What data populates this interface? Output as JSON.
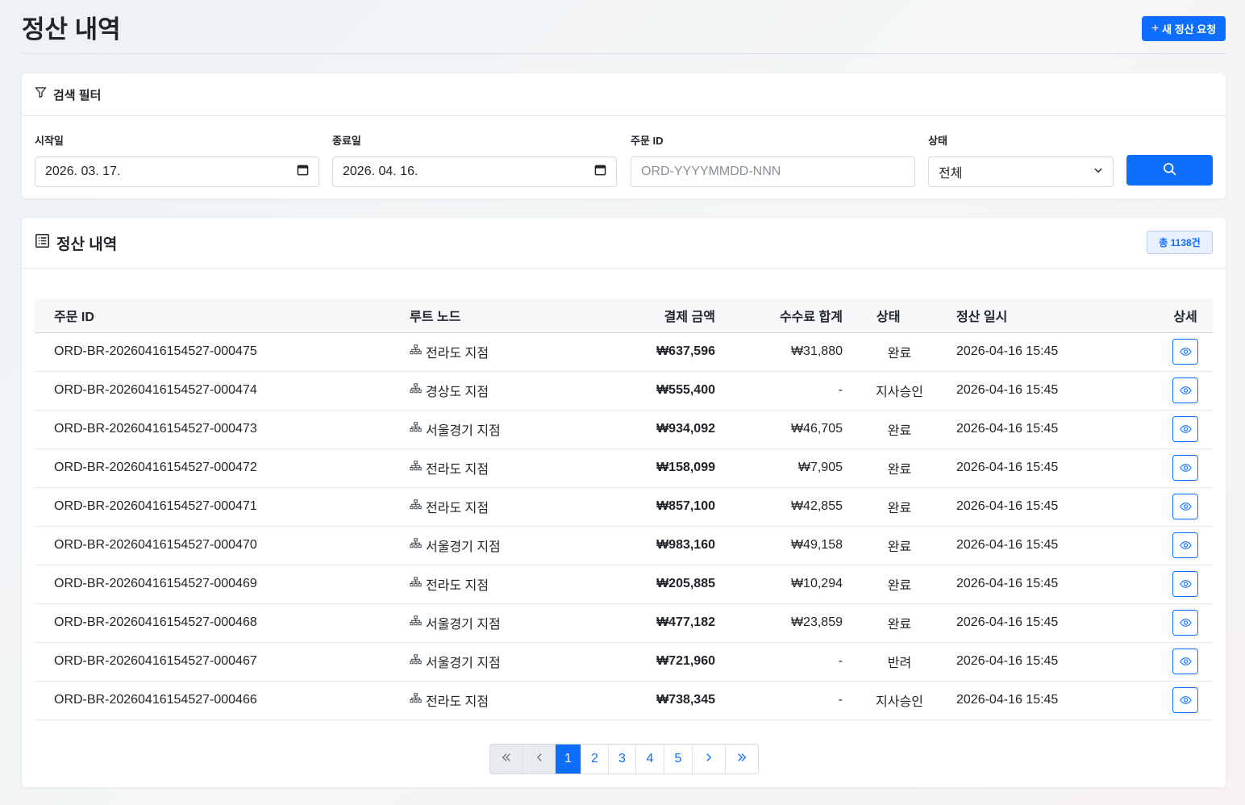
{
  "header": {
    "title": "정산 내역",
    "new_button_label": "새 정산 요청"
  },
  "filter": {
    "title": "검색 필터",
    "start_label": "시작일",
    "start_value": "2026. 03. 17.",
    "end_label": "종료일",
    "end_value": "2026. 04. 16.",
    "order_label": "주문 ID",
    "order_placeholder": "ORD-YYYYMMDD-NNN",
    "status_label": "상태",
    "status_value": "전체"
  },
  "list": {
    "title": "정산 내역",
    "total_badge": "총 1138건",
    "columns": {
      "order_id": "주문 ID",
      "root_node": "루트 노드",
      "amount": "결제 금액",
      "fee": "수수료 합계",
      "status": "상태",
      "settled_at": "정산 일시",
      "detail": "상세"
    },
    "rows": [
      {
        "order_id": "ORD-BR-20260416154527-000475",
        "node": "전라도 지점",
        "amount": "₩637,596",
        "fee": "₩31,880",
        "status": "완료",
        "date": "2026-04-16 15:45"
      },
      {
        "order_id": "ORD-BR-20260416154527-000474",
        "node": "경상도 지점",
        "amount": "₩555,400",
        "fee": "-",
        "status": "지사승인",
        "date": "2026-04-16 15:45"
      },
      {
        "order_id": "ORD-BR-20260416154527-000473",
        "node": "서울경기 지점",
        "amount": "₩934,092",
        "fee": "₩46,705",
        "status": "완료",
        "date": "2026-04-16 15:45"
      },
      {
        "order_id": "ORD-BR-20260416154527-000472",
        "node": "전라도 지점",
        "amount": "₩158,099",
        "fee": "₩7,905",
        "status": "완료",
        "date": "2026-04-16 15:45"
      },
      {
        "order_id": "ORD-BR-20260416154527-000471",
        "node": "전라도 지점",
        "amount": "₩857,100",
        "fee": "₩42,855",
        "status": "완료",
        "date": "2026-04-16 15:45"
      },
      {
        "order_id": "ORD-BR-20260416154527-000470",
        "node": "서울경기 지점",
        "amount": "₩983,160",
        "fee": "₩49,158",
        "status": "완료",
        "date": "2026-04-16 15:45"
      },
      {
        "order_id": "ORD-BR-20260416154527-000469",
        "node": "전라도 지점",
        "amount": "₩205,885",
        "fee": "₩10,294",
        "status": "완료",
        "date": "2026-04-16 15:45"
      },
      {
        "order_id": "ORD-BR-20260416154527-000468",
        "node": "서울경기 지점",
        "amount": "₩477,182",
        "fee": "₩23,859",
        "status": "완료",
        "date": "2026-04-16 15:45"
      },
      {
        "order_id": "ORD-BR-20260416154527-000467",
        "node": "서울경기 지점",
        "amount": "₩721,960",
        "fee": "-",
        "status": "반려",
        "date": "2026-04-16 15:45"
      },
      {
        "order_id": "ORD-BR-20260416154527-000466",
        "node": "전라도 지점",
        "amount": "₩738,345",
        "fee": "-",
        "status": "지사승인",
        "date": "2026-04-16 15:45"
      }
    ]
  },
  "pagination": {
    "pages": [
      "1",
      "2",
      "3",
      "4",
      "5"
    ],
    "current": "1"
  },
  "colors": {
    "accent": "#0d6efd",
    "badge_bg": "#e7f1ff"
  },
  "icons": {
    "filter": "funnel-icon",
    "list": "list-document-icon",
    "node": "sitemap-icon",
    "detail": "eye-icon",
    "search": "search-icon",
    "calendar": "calendar-icon"
  }
}
